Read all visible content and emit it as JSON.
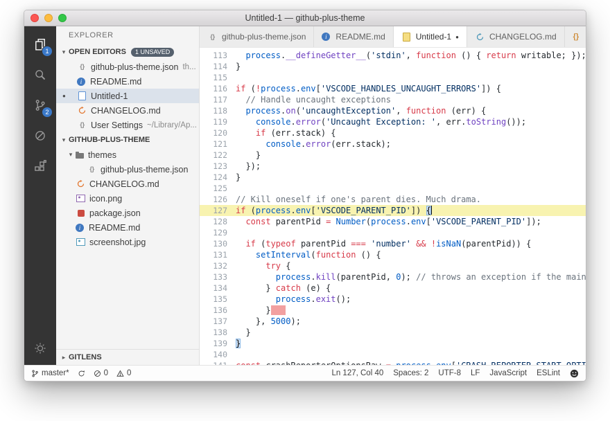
{
  "window": {
    "title": "Untitled-1 — github-plus-theme"
  },
  "activity_bar": {
    "items": [
      {
        "key": "explorer",
        "badge": "1",
        "active": true
      },
      {
        "key": "search"
      },
      {
        "key": "source-control",
        "badge": "2"
      },
      {
        "key": "debug"
      },
      {
        "key": "extensions"
      }
    ]
  },
  "sidebar": {
    "title": "EXPLORER",
    "sections": [
      {
        "label": "OPEN EDITORS",
        "badge": "1 UNSAVED",
        "expanded": true,
        "kind": "open-editors",
        "items": [
          {
            "icon": "json",
            "label": "github-plus-theme.json",
            "detail": "th..."
          },
          {
            "icon": "readme",
            "label": "README.md"
          },
          {
            "icon": "doc",
            "label": "Untitled-1",
            "selected": true,
            "modified": true
          },
          {
            "icon": "changelog",
            "label": "CHANGELOG.md"
          },
          {
            "icon": "json",
            "label": "User Settings",
            "detail": "~/Library/Ap..."
          }
        ]
      },
      {
        "label": "GITHUB-PLUS-THEME",
        "expanded": true,
        "kind": "tree",
        "items": [
          {
            "icon": "folder",
            "label": "themes",
            "folder": true,
            "expanded": true,
            "indent": 0
          },
          {
            "icon": "json",
            "label": "github-plus-theme.json",
            "indent": 1
          },
          {
            "icon": "changelog",
            "label": "CHANGELOG.md",
            "indent": 0
          },
          {
            "icon": "image",
            "label": "icon.png",
            "indent": 0
          },
          {
            "icon": "npm",
            "label": "package.json",
            "indent": 0
          },
          {
            "icon": "readme",
            "label": "README.md",
            "indent": 0
          },
          {
            "icon": "image2",
            "label": "screenshot.jpg",
            "indent": 0
          }
        ]
      },
      {
        "label": "GITLENS",
        "expanded": false,
        "kind": "pinned",
        "items": []
      }
    ]
  },
  "tabs": {
    "items": [
      {
        "icon": "json",
        "label": "github-plus-theme.json"
      },
      {
        "icon": "readme",
        "label": "README.md"
      },
      {
        "icon": "doc-yellow",
        "label": "Untitled-1",
        "active": true,
        "modified": true
      },
      {
        "icon": "changelog-teal",
        "label": "CHANGELOG.md"
      }
    ],
    "actions": [
      {
        "key": "curly",
        "label": "{}"
      },
      {
        "key": "preview"
      },
      {
        "key": "split"
      },
      {
        "key": "more",
        "label": "···"
      }
    ]
  },
  "editor": {
    "lines": [
      {
        "n": 113,
        "seg": [
          [
            "p",
            "  "
          ],
          [
            "b",
            "process"
          ],
          [
            "p",
            "."
          ],
          [
            "f",
            "__defineGetter__"
          ],
          [
            "p",
            "("
          ],
          [
            "s",
            "'stdin'"
          ],
          [
            "p",
            ", "
          ],
          [
            "k",
            "function"
          ],
          [
            "p",
            " () { "
          ],
          [
            "k",
            "return"
          ],
          [
            "p",
            " writable; });"
          ]
        ]
      },
      {
        "n": 114,
        "seg": [
          [
            "p",
            "}"
          ]
        ]
      },
      {
        "n": 115,
        "seg": []
      },
      {
        "n": 116,
        "seg": [
          [
            "k",
            "if"
          ],
          [
            "p",
            " ("
          ],
          [
            "k",
            "!"
          ],
          [
            "b",
            "process"
          ],
          [
            "p",
            "."
          ],
          [
            "b",
            "env"
          ],
          [
            "p",
            "["
          ],
          [
            "s",
            "'VSCODE_HANDLES_UNCAUGHT_ERRORS'"
          ],
          [
            "p",
            "]) {"
          ]
        ]
      },
      {
        "n": 117,
        "seg": [
          [
            "c",
            "  // Handle uncaught exceptions"
          ]
        ]
      },
      {
        "n": 118,
        "seg": [
          [
            "p",
            "  "
          ],
          [
            "b",
            "process"
          ],
          [
            "p",
            "."
          ],
          [
            "f",
            "on"
          ],
          [
            "p",
            "("
          ],
          [
            "s",
            "'uncaughtException'"
          ],
          [
            "p",
            ", "
          ],
          [
            "k",
            "function"
          ],
          [
            "p",
            " (err) {"
          ]
        ]
      },
      {
        "n": 119,
        "seg": [
          [
            "p",
            "    "
          ],
          [
            "b",
            "console"
          ],
          [
            "p",
            "."
          ],
          [
            "f",
            "error"
          ],
          [
            "p",
            "("
          ],
          [
            "s",
            "'Uncaught Exception: '"
          ],
          [
            "p",
            ", err."
          ],
          [
            "f",
            "toString"
          ],
          [
            "p",
            "());"
          ]
        ]
      },
      {
        "n": 120,
        "seg": [
          [
            "p",
            "    "
          ],
          [
            "k",
            "if"
          ],
          [
            "p",
            " (err.stack) {"
          ]
        ]
      },
      {
        "n": 121,
        "seg": [
          [
            "p",
            "      "
          ],
          [
            "b",
            "console"
          ],
          [
            "p",
            "."
          ],
          [
            "f",
            "error"
          ],
          [
            "p",
            "(err.stack);"
          ]
        ]
      },
      {
        "n": 122,
        "seg": [
          [
            "p",
            "    }"
          ]
        ]
      },
      {
        "n": 123,
        "seg": [
          [
            "p",
            "  });"
          ]
        ]
      },
      {
        "n": 124,
        "seg": [
          [
            "p",
            "}"
          ]
        ]
      },
      {
        "n": 125,
        "seg": []
      },
      {
        "n": 126,
        "seg": [
          [
            "c",
            "// Kill oneself if one's parent dies. Much drama."
          ]
        ]
      },
      {
        "n": 127,
        "hl": true,
        "seg": [
          [
            "k",
            "if"
          ],
          [
            "p",
            " ("
          ],
          [
            "b",
            "process"
          ],
          [
            "p",
            "."
          ],
          [
            "b",
            "env"
          ],
          [
            "p",
            "["
          ],
          [
            "s",
            "'VSCODE_PARENT_PID'"
          ],
          [
            "p",
            "]) "
          ],
          [
            "brk",
            "{"
          ],
          [
            "cur",
            ""
          ]
        ]
      },
      {
        "n": 128,
        "seg": [
          [
            "p",
            "  "
          ],
          [
            "k",
            "const"
          ],
          [
            "p",
            " parentPid "
          ],
          [
            "k",
            "="
          ],
          [
            "p",
            " "
          ],
          [
            "b",
            "Number"
          ],
          [
            "p",
            "("
          ],
          [
            "b",
            "process"
          ],
          [
            "p",
            "."
          ],
          [
            "b",
            "env"
          ],
          [
            "p",
            "["
          ],
          [
            "s",
            "'VSCODE_PARENT_PID'"
          ],
          [
            "p",
            "]);"
          ]
        ]
      },
      {
        "n": 129,
        "seg": []
      },
      {
        "n": 130,
        "seg": [
          [
            "p",
            "  "
          ],
          [
            "k",
            "if"
          ],
          [
            "p",
            " ("
          ],
          [
            "k",
            "typeof"
          ],
          [
            "p",
            " parentPid "
          ],
          [
            "k",
            "==="
          ],
          [
            "p",
            " "
          ],
          [
            "s",
            "'number'"
          ],
          [
            "p",
            " "
          ],
          [
            "k",
            "&&"
          ],
          [
            "p",
            " "
          ],
          [
            "k",
            "!"
          ],
          [
            "b",
            "isNaN"
          ],
          [
            "p",
            "(parentPid)) {"
          ]
        ]
      },
      {
        "n": 131,
        "seg": [
          [
            "p",
            "    "
          ],
          [
            "b",
            "setInterval"
          ],
          [
            "p",
            "("
          ],
          [
            "k",
            "function"
          ],
          [
            "p",
            " () {"
          ]
        ]
      },
      {
        "n": 132,
        "seg": [
          [
            "p",
            "      "
          ],
          [
            "k",
            "try"
          ],
          [
            "p",
            " {"
          ]
        ]
      },
      {
        "n": 133,
        "seg": [
          [
            "p",
            "        "
          ],
          [
            "b",
            "process"
          ],
          [
            "p",
            "."
          ],
          [
            "f",
            "kill"
          ],
          [
            "p",
            "(parentPid, "
          ],
          [
            "b",
            "0"
          ],
          [
            "p",
            "); "
          ],
          [
            "c",
            "// throws an exception if the main process doesn't exist anymore."
          ]
        ]
      },
      {
        "n": 134,
        "seg": [
          [
            "p",
            "      } "
          ],
          [
            "k",
            "catch"
          ],
          [
            "p",
            " (e) {"
          ]
        ]
      },
      {
        "n": 135,
        "seg": [
          [
            "p",
            "        "
          ],
          [
            "b",
            "process"
          ],
          [
            "p",
            "."
          ],
          [
            "f",
            "exit"
          ],
          [
            "p",
            "();"
          ]
        ]
      },
      {
        "n": 136,
        "seg": [
          [
            "p",
            "      }"
          ],
          [
            "err",
            "   "
          ]
        ]
      },
      {
        "n": 137,
        "seg": [
          [
            "p",
            "    }, "
          ],
          [
            "b",
            "5000"
          ],
          [
            "p",
            ");"
          ]
        ]
      },
      {
        "n": 138,
        "seg": [
          [
            "p",
            "  }"
          ]
        ]
      },
      {
        "n": 139,
        "seg": [
          [
            "brk",
            "}"
          ]
        ]
      },
      {
        "n": 140,
        "seg": []
      },
      {
        "n": 141,
        "seg": [
          [
            "k",
            "const"
          ],
          [
            "p",
            " crashReporterOptionsRaw "
          ],
          [
            "k",
            "="
          ],
          [
            "p",
            " "
          ],
          [
            "b",
            "process"
          ],
          [
            "p",
            "."
          ],
          [
            "b",
            "env"
          ],
          [
            "p",
            "["
          ],
          [
            "s",
            "'CRASH_REPORTER_START_OPTIONS'"
          ],
          [
            "p",
            "];"
          ]
        ]
      }
    ]
  },
  "status_bar": {
    "left": [
      {
        "icon": "branch",
        "label": "master*",
        "name": "git-branch"
      },
      {
        "icon": "sync",
        "name": "sync"
      },
      {
        "icon": "error",
        "label": "0",
        "name": "errors"
      },
      {
        "icon": "warning",
        "label": "0",
        "name": "warnings"
      }
    ],
    "right": [
      {
        "label": "Ln 127, Col 40",
        "name": "cursor-position"
      },
      {
        "label": "Spaces: 2",
        "name": "indentation"
      },
      {
        "label": "UTF-8",
        "name": "encoding"
      },
      {
        "label": "LF",
        "name": "eol"
      },
      {
        "label": "JavaScript",
        "name": "language-mode"
      },
      {
        "label": "ESLint",
        "name": "eslint"
      },
      {
        "icon": "smiley",
        "name": "feedback"
      }
    ]
  }
}
